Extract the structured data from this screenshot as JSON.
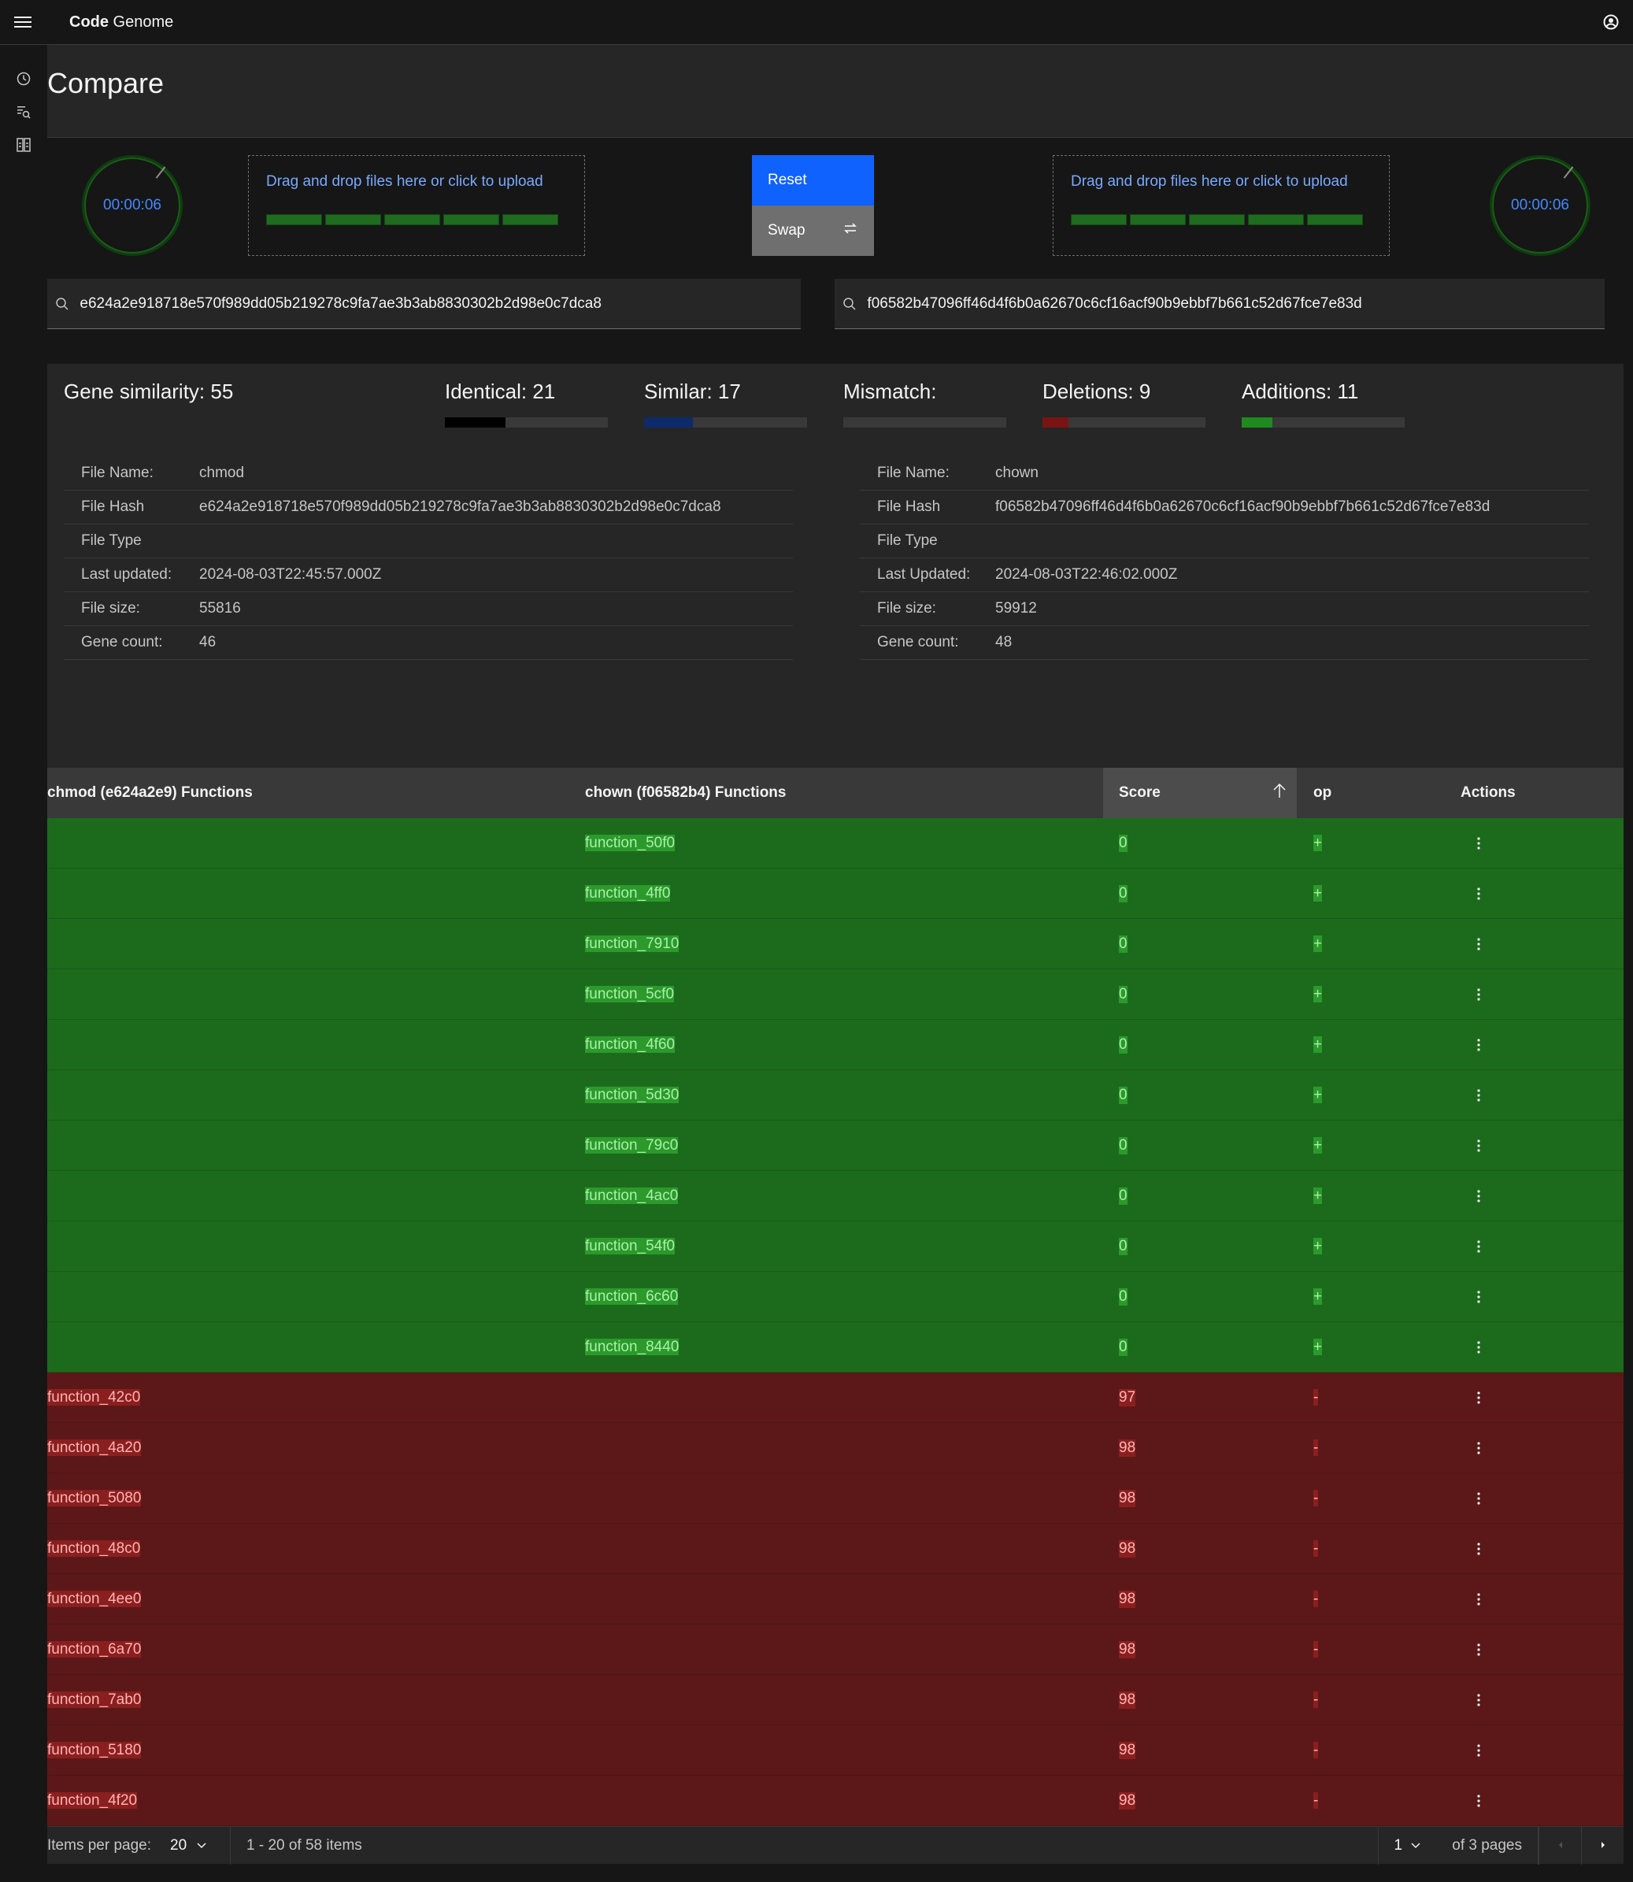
{
  "app": {
    "brand_bold": "Code",
    "brand_rest": " Genome"
  },
  "page": {
    "title": "Compare"
  },
  "left": {
    "timer": "00:00:06",
    "upload_label": "Drag and drop files here or click to upload",
    "search_value": "e624a2e918718e570f989dd05b219278c9fa7ae3b3ab8830302b2d98e0c7dca8"
  },
  "right": {
    "timer": "00:00:06",
    "upload_label": "Drag and drop files here or click to upload",
    "search_value": "f06582b47096ff46d4f6b0a62670c6cf16acf90b9ebbf7b661c52d67fce7e83d"
  },
  "buttons": {
    "reset": "Reset",
    "swap": "Swap"
  },
  "stats": {
    "gene_similarity": "Gene similarity: 55",
    "identical": "Identical: 21",
    "similar": "Similar: 17",
    "mismatch": "Mismatch:",
    "deletions": "Deletions: 9",
    "additions": "Additions: 11",
    "identical_fraction": 0.37,
    "similar_fraction": 0.3,
    "mismatch_fraction": 0,
    "deletions_fraction": 0.16,
    "additions_fraction": 0.19,
    "colors": {
      "identical": "#000000",
      "similar": "#0d2b6b",
      "deletions": "#7a1414",
      "additions": "#1f8a1f"
    }
  },
  "file_left": {
    "rows": [
      {
        "k": "File Name:",
        "v": "chmod"
      },
      {
        "k": "File Hash",
        "v": "e624a2e918718e570f989dd05b219278c9fa7ae3b3ab8830302b2d98e0c7dca8"
      },
      {
        "k": "File Type",
        "v": ""
      },
      {
        "k": "Last updated:",
        "v": "2024-08-03T22:45:57.000Z"
      },
      {
        "k": "File size:",
        "v": "55816"
      },
      {
        "k": "Gene count:",
        "v": "46"
      }
    ]
  },
  "file_right": {
    "rows": [
      {
        "k": "File Name:",
        "v": "chown"
      },
      {
        "k": "File Hash",
        "v": "f06582b47096ff46d4f6b0a62670c6cf16acf90b9ebbf7b661c52d67fce7e83d"
      },
      {
        "k": "File Type",
        "v": ""
      },
      {
        "k": "Last Updated:",
        "v": "2024-08-03T22:46:02.000Z"
      },
      {
        "k": "File size:",
        "v": "59912"
      },
      {
        "k": "Gene count:",
        "v": "48"
      }
    ]
  },
  "table": {
    "headers": [
      "chmod (e624a2e9) Functions",
      "chown (f06582b4) Functions",
      "Score",
      "op",
      "Actions"
    ],
    "rows": [
      {
        "left": "",
        "right": "function_50f0",
        "score": "0",
        "op": "+",
        "type": "add"
      },
      {
        "left": "",
        "right": "function_4ff0",
        "score": "0",
        "op": "+",
        "type": "add"
      },
      {
        "left": "",
        "right": "function_7910",
        "score": "0",
        "op": "+",
        "type": "add"
      },
      {
        "left": "",
        "right": "function_5cf0",
        "score": "0",
        "op": "+",
        "type": "add"
      },
      {
        "left": "",
        "right": "function_4f60",
        "score": "0",
        "op": "+",
        "type": "add"
      },
      {
        "left": "",
        "right": "function_5d30",
        "score": "0",
        "op": "+",
        "type": "add"
      },
      {
        "left": "",
        "right": "function_79c0",
        "score": "0",
        "op": "+",
        "type": "add"
      },
      {
        "left": "",
        "right": "function_4ac0",
        "score": "0",
        "op": "+",
        "type": "add"
      },
      {
        "left": "",
        "right": "function_54f0",
        "score": "0",
        "op": "+",
        "type": "add"
      },
      {
        "left": "",
        "right": "function_6c60",
        "score": "0",
        "op": "+",
        "type": "add"
      },
      {
        "left": "",
        "right": "function_8440",
        "score": "0",
        "op": "+",
        "type": "add"
      },
      {
        "left": "function_42c0",
        "right": "",
        "score": "97",
        "op": "-",
        "type": "del"
      },
      {
        "left": "function_4a20",
        "right": "",
        "score": "98",
        "op": "-",
        "type": "del"
      },
      {
        "left": "function_5080",
        "right": "",
        "score": "98",
        "op": "-",
        "type": "del"
      },
      {
        "left": "function_48c0",
        "right": "",
        "score": "98",
        "op": "-",
        "type": "del"
      },
      {
        "left": "function_4ee0",
        "right": "",
        "score": "98",
        "op": "-",
        "type": "del"
      },
      {
        "left": "function_6a70",
        "right": "",
        "score": "98",
        "op": "-",
        "type": "del"
      },
      {
        "left": "function_7ab0",
        "right": "",
        "score": "98",
        "op": "-",
        "type": "del"
      },
      {
        "left": "function_5180",
        "right": "",
        "score": "98",
        "op": "-",
        "type": "del"
      },
      {
        "left": "function_4f20",
        "right": "",
        "score": "98",
        "op": "-",
        "type": "del"
      }
    ]
  },
  "pagination": {
    "items_per_page_label": "Items per page:",
    "items_per_page": "20",
    "range": "1 - 20 of 58 items",
    "page": "1",
    "of_pages": "of 3 pages"
  }
}
